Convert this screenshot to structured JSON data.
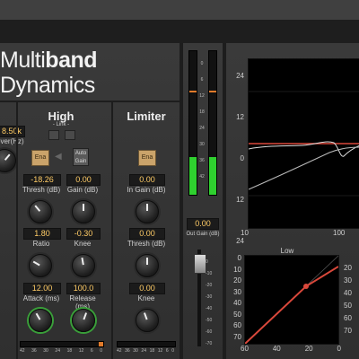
{
  "plugin": {
    "title_light": "Multi",
    "title_bold": "band",
    "title_line2": "Dynamics"
  },
  "left_band": {
    "freq_value": "8.50k",
    "crossover_label": "over(Hz)"
  },
  "high": {
    "title": "High",
    "link_label": "- Link -",
    "ena_label": "Ena",
    "auto_gain_label": "Auto\nGain",
    "thresh_value": "-18.26",
    "thresh_label": "Thresh (dB)",
    "gain_value": "0.00",
    "gain_label": "Gain (dB)",
    "ratio_value": "1.80",
    "ratio_label": "Ratio",
    "knee_value": "-0.30",
    "knee_label": "Knee",
    "attack_value": "12.00",
    "attack_label": "Attack (ms)",
    "release_value": "100.0",
    "release_label": "Release (ms)",
    "gr_scale": [
      "42",
      "36",
      "30",
      "24",
      "18",
      "12",
      "6",
      "0"
    ]
  },
  "limiter": {
    "title": "Limiter",
    "ena_label": "Ena",
    "in_gain_value": "0.00",
    "in_gain_label": "In Gain (dB)",
    "thresh_value": "0.00",
    "thresh_label": "Thresh (dB)",
    "knee_value": "0.00",
    "knee_label": "Knee",
    "gr_scale": [
      "42",
      "36",
      "30",
      "24",
      "18",
      "12",
      "6",
      "0"
    ]
  },
  "output": {
    "meter_scale": [
      "0",
      "6",
      "12",
      "18",
      "24",
      "30",
      "36",
      "42"
    ],
    "out_gain_value": "0.00",
    "out_gain_label": "Out Gain (dB)",
    "fader_scale": [
      "0",
      "-10",
      "-20",
      "-30",
      "-40",
      "-50",
      "-60",
      "-70"
    ]
  },
  "freq_graph": {
    "y_labels": [
      "24",
      "12",
      "0",
      "12",
      "24"
    ],
    "x_labels": [
      "10",
      "100"
    ]
  },
  "transfer_graph": {
    "title": "Low",
    "y_labels": [
      "0",
      "10",
      "20",
      "30",
      "40",
      "50",
      "60",
      "70"
    ],
    "x_labels": [
      "60",
      "40",
      "20",
      "0"
    ],
    "right_labels": [
      "20",
      "30",
      "40",
      "50",
      "60",
      "70"
    ]
  },
  "colors": {
    "accent_orange": "#e07a2a",
    "meter_green": "#2fd12f",
    "curve_red": "#d9483b",
    "value_text": "#ffcc66"
  }
}
